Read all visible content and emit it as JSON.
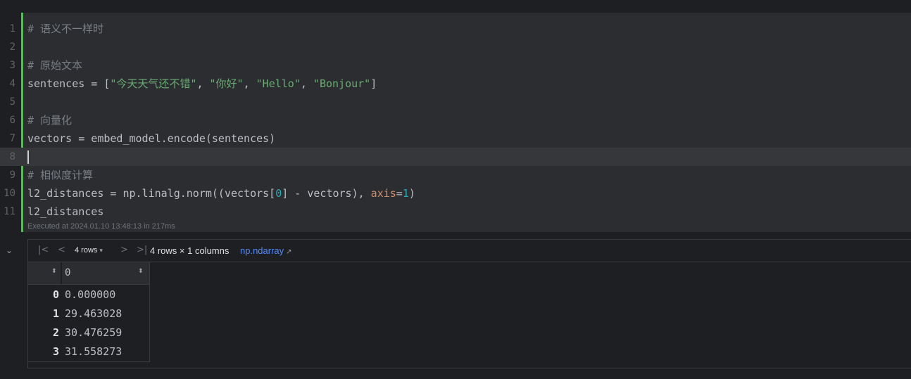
{
  "code_cell": {
    "lines": [
      {
        "num": "1",
        "tokens": [
          {
            "t": "# 语义不一样时",
            "c": "cm"
          }
        ]
      },
      {
        "num": "2",
        "tokens": []
      },
      {
        "num": "3",
        "tokens": [
          {
            "t": "# 原始文本",
            "c": "cm"
          }
        ]
      },
      {
        "num": "4",
        "tokens": [
          {
            "t": "sentences = [",
            "c": ""
          },
          {
            "t": "\"今天天气还不错\"",
            "c": "str"
          },
          {
            "t": ", ",
            "c": ""
          },
          {
            "t": "\"你好\"",
            "c": "str"
          },
          {
            "t": ", ",
            "c": ""
          },
          {
            "t": "\"Hello\"",
            "c": "str"
          },
          {
            "t": ", ",
            "c": ""
          },
          {
            "t": "\"Bonjour\"",
            "c": "str"
          },
          {
            "t": "]",
            "c": ""
          }
        ]
      },
      {
        "num": "5",
        "tokens": []
      },
      {
        "num": "6",
        "tokens": [
          {
            "t": "# 向量化",
            "c": "cm"
          }
        ]
      },
      {
        "num": "7",
        "tokens": [
          {
            "t": "vectors = embed_model.encode(sentences)",
            "c": ""
          }
        ]
      },
      {
        "num": "8",
        "tokens": [],
        "current": true
      },
      {
        "num": "9",
        "tokens": [
          {
            "t": "# 相似度计算",
            "c": "cm"
          }
        ]
      },
      {
        "num": "10",
        "tokens": [
          {
            "t": "l2_distances = np.linalg.norm((vectors[",
            "c": ""
          },
          {
            "t": "0",
            "c": "num"
          },
          {
            "t": "] - vectors), ",
            "c": ""
          },
          {
            "t": "axis",
            "c": "kw"
          },
          {
            "t": "=",
            "c": ""
          },
          {
            "t": "1",
            "c": "num"
          },
          {
            "t": ")",
            "c": ""
          }
        ]
      },
      {
        "num": "11",
        "tokens": [
          {
            "t": "l2_distances",
            "c": ""
          }
        ]
      }
    ],
    "execution_info": "Executed at 2024.01.10 13:48:13 in 217ms"
  },
  "output": {
    "collapse_icon": "chevron-down-icon",
    "toolbar": {
      "first_icon": "first-page-icon",
      "prev_icon": "prev-page-icon",
      "next_icon": "next-page-icon",
      "last_icon": "last-page-icon",
      "rows_selector": "4 rows",
      "summary": "4 rows × 1 columns",
      "type_link": "np.ndarray"
    },
    "table": {
      "columns": [
        "0"
      ],
      "rows": [
        {
          "index": "0",
          "value": "0.000000"
        },
        {
          "index": "1",
          "value": "29.463028"
        },
        {
          "index": "2",
          "value": "30.476259"
        },
        {
          "index": "3",
          "value": "31.558273"
        }
      ]
    }
  },
  "colors": {
    "background": "#1e1f22",
    "cell_background": "#2b2d30",
    "cell_active_bar": "#5fb85f",
    "comment": "#7a7e85",
    "string": "#6aab73",
    "number": "#2aacb8",
    "keyword_arg": "#cf8e6d",
    "link": "#548af7"
  }
}
